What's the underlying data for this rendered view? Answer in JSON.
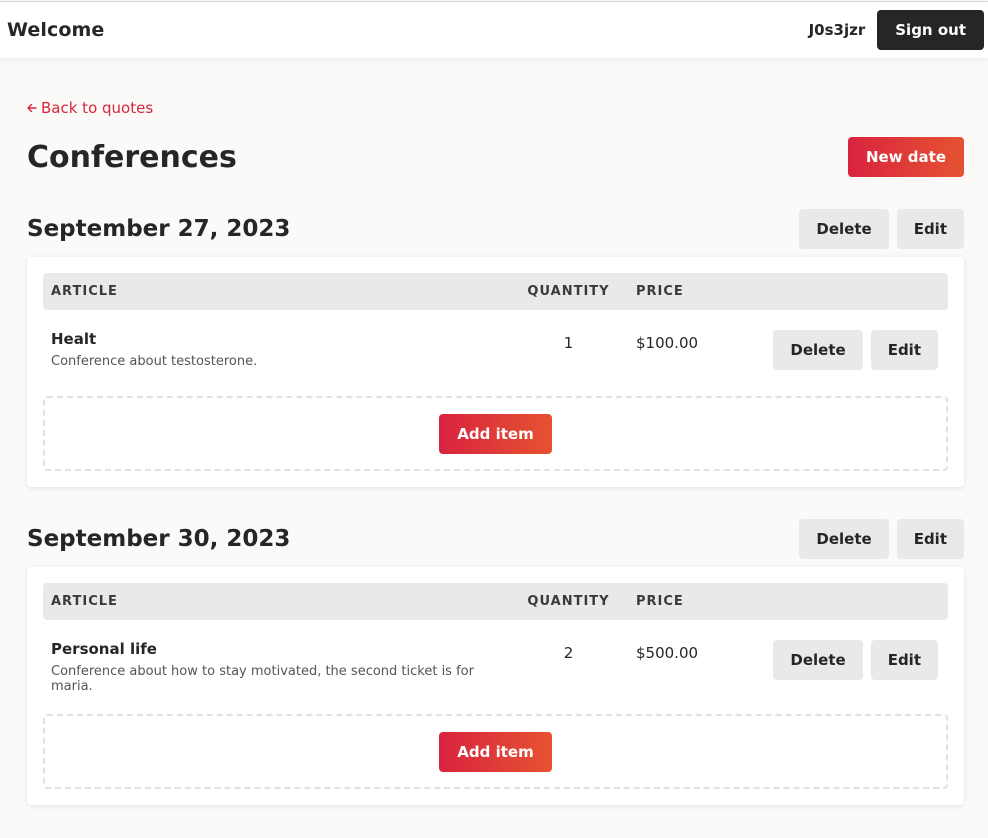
{
  "header": {
    "title": "Welcome",
    "username": "J0s3jzr",
    "signout_label": "Sign out"
  },
  "nav": {
    "back_label": "Back to quotes",
    "back_icon": "arrow-left-icon"
  },
  "page": {
    "title": "Conferences",
    "new_date_label": "New date"
  },
  "colors": {
    "accent": "#d6273c",
    "dark": "#262626",
    "light_button": "#ebe9e8"
  },
  "table_headers": {
    "article": "ARTICLE",
    "quantity": "QUANTITY",
    "price": "PRICE"
  },
  "actions": {
    "delete": "Delete",
    "edit": "Edit",
    "add_item": "Add item"
  },
  "dates": [
    {
      "date": "September 27, 2023",
      "items": [
        {
          "name": "Healt",
          "description": "Conference about testosterone.",
          "quantity": "1",
          "price": "$100.00"
        }
      ]
    },
    {
      "date": "September 30, 2023",
      "items": [
        {
          "name": "Personal life",
          "description": "Conference about how to stay motivated, the second ticket is for maria.",
          "quantity": "2",
          "price": "$500.00"
        }
      ]
    }
  ]
}
